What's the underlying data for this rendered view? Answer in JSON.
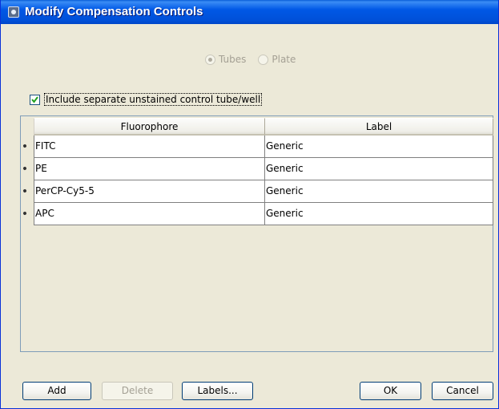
{
  "window": {
    "title": "Modify Compensation Controls"
  },
  "radio_group": {
    "tubes_label": "Tubes",
    "tubes_selected": true,
    "plate_label": "Plate",
    "plate_selected": false,
    "enabled": false
  },
  "include_unstained": {
    "label": "Include separate unstained control tube/well",
    "checked": true
  },
  "table": {
    "columns": [
      "Fluorophore",
      "Label"
    ],
    "rows": [
      {
        "fluorophore": "FITC",
        "label": "Generic"
      },
      {
        "fluorophore": "PE",
        "label": "Generic"
      },
      {
        "fluorophore": "PerCP-Cy5-5",
        "label": "Generic"
      },
      {
        "fluorophore": "APC",
        "label": "Generic"
      }
    ]
  },
  "buttons": {
    "add": "Add",
    "delete": "Delete",
    "labels": "Labels...",
    "ok": "OK",
    "cancel": "Cancel"
  },
  "colors": {
    "titlebar": "#0058e6",
    "dialog_bg": "#ece9d8",
    "checkmark": "#21a121"
  }
}
